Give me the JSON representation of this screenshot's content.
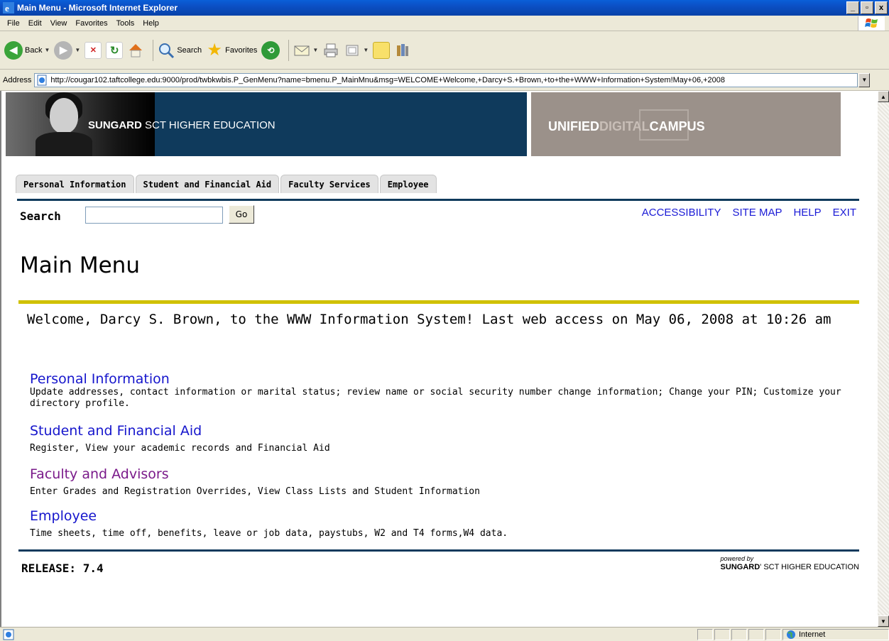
{
  "window": {
    "title": "Main Menu - Microsoft Internet Explorer",
    "min": "_",
    "max": "▫",
    "close": "x"
  },
  "menubar": [
    {
      "label": "File"
    },
    {
      "label": "Edit"
    },
    {
      "label": "View"
    },
    {
      "label": "Favorites"
    },
    {
      "label": "Tools"
    },
    {
      "label": "Help"
    }
  ],
  "toolbar": {
    "back": "Back",
    "search": "Search",
    "favorites": "Favorites"
  },
  "address": {
    "label": "Address",
    "url": "http://cougar102.taftcollege.edu:9000/prod/twbkwbis.P_GenMenu?name=bmenu.P_MainMnu&msg=WELCOME+Welcome,+Darcy+S.+Brown,+to+the+WWW+Information+System!May+06,+2008"
  },
  "banner": {
    "sungard_bold": "SUNGARD",
    "sungard_rest": " SCT HIGHER EDUCATION",
    "udc_unified": "UNIFIED",
    "udc_digital": "DIGITAL",
    "udc_campus": "CAMPUS"
  },
  "tabs": [
    {
      "label": "Personal Information"
    },
    {
      "label": "Student and Financial Aid"
    },
    {
      "label": "Faculty Services"
    },
    {
      "label": "Employee"
    }
  ],
  "search": {
    "label": "Search",
    "value": "",
    "go": "Go"
  },
  "toplinks": [
    {
      "label": "ACCESSIBILITY"
    },
    {
      "label": "SITE MAP"
    },
    {
      "label": "HELP"
    },
    {
      "label": "EXIT"
    }
  ],
  "page_title": "Main Menu",
  "welcome": "Welcome, Darcy S. Brown, to the WWW Information System! Last web access on May 06, 2008 at 10:26 am",
  "menu": [
    {
      "title": "Personal Information",
      "desc": "Update addresses, contact information or marital status; review name or social security number change information; Change your PIN; Customize your directory profile."
    },
    {
      "title": "Student and Financial Aid",
      "desc": "Register, View your academic records and Financial Aid"
    },
    {
      "title": "Faculty and Advisors",
      "desc": "Enter Grades and Registration Overrides, View Class Lists and Student Information"
    },
    {
      "title": "Employee",
      "desc": "Time sheets, time off, benefits, leave or job data, paystubs, W2 and T4 forms,W4 data."
    }
  ],
  "footer": {
    "release": "RELEASE: 7.4",
    "powered_by": "powered by",
    "powered_bold": "SUNGARD",
    "powered_rest": "' SCT HIGHER EDUCATION"
  },
  "statusbar": {
    "zone": "Internet"
  },
  "colors": {
    "link": "#1515cc",
    "visited": "#7a1a8a",
    "navy": "#0f3a5c",
    "accent_yellow": "#d0c100"
  }
}
